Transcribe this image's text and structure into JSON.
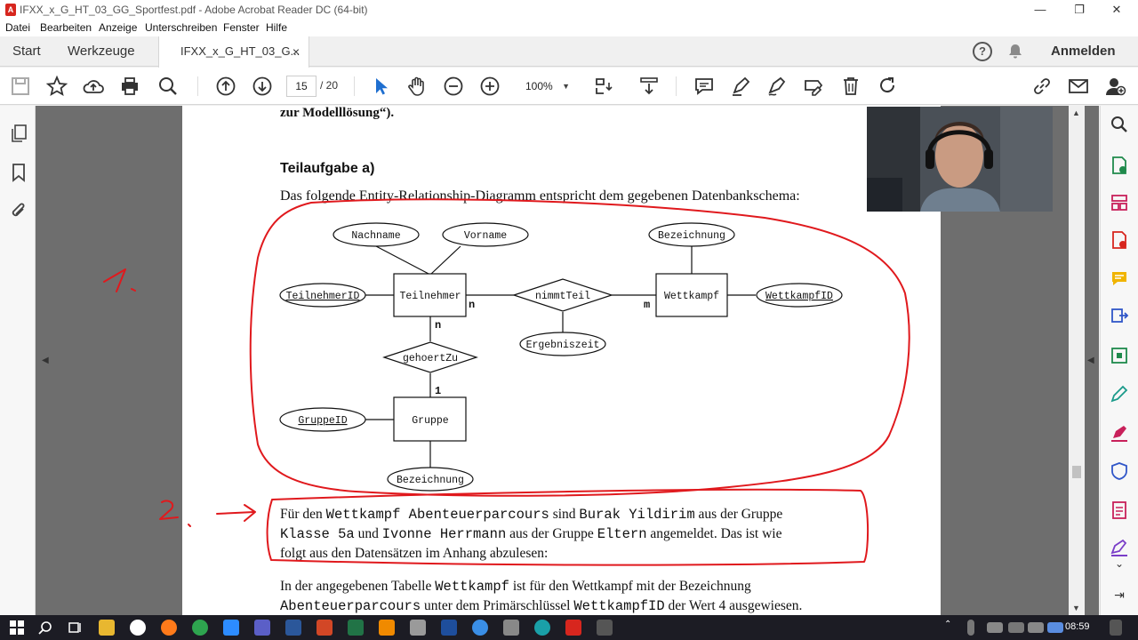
{
  "window": {
    "title": "IFXX_x_G_HT_03_GG_Sportfest.pdf - Adobe Acrobat Reader DC (64-bit)",
    "minimize": "—",
    "maximize": "❐",
    "close": "✕"
  },
  "menu": [
    "Datei",
    "Bearbeiten",
    "Anzeige",
    "Unterschreiben",
    "Fenster",
    "Hilfe"
  ],
  "tabs": {
    "start": "Start",
    "tools": "Werkzeuge",
    "doc": "IFXX_x_G_HT_03_G...",
    "doc_close": "×",
    "help": "?",
    "login": "Anmelden"
  },
  "toolbar": {
    "page_current": "15",
    "page_total": "/  20",
    "zoom": "100%"
  },
  "document": {
    "top_line": "zur Modelllösung“).",
    "heading": "Teilaufgabe a)",
    "intro": "Das folgende Entity-Relationship-Diagramm entspricht dem gegebenen Datenbankschema:",
    "er": {
      "entities": [
        "Teilnehmer",
        "Wettkampf",
        "Gruppe"
      ],
      "relationships": [
        "nimmtTeil",
        "gehoertZu"
      ],
      "attributes": [
        "Nachname",
        "Vorname",
        "Bezeichnung",
        "TeilnehmerID",
        "WettkampfID",
        "Ergebniszeit",
        "GruppeID",
        "Bezeichnung"
      ],
      "cardinalities": [
        "n",
        "m",
        "n",
        "1"
      ]
    },
    "para1": {
      "l1a": "Für den ",
      "l1b": "Wettkampf Abenteuerparcours",
      "l1c": " sind ",
      "l1d": "Burak Yildirim",
      "l1e": " aus der Gruppe",
      "l2a": "Klasse 5a",
      "l2b": " und ",
      "l2c": "Ivonne Herrmann",
      "l2d": " aus der Gruppe ",
      "l2e": "Eltern",
      "l2f": " angemeldet. Das ist wie",
      "l3": "folgt aus den Datensätzen im Anhang abzulesen:"
    },
    "para2": {
      "l1a": "In der angegebenen Tabelle ",
      "l1b": "Wettkampf",
      "l1c": " ist für den Wettkampf mit der Bezeichnung",
      "l2a": "Abenteuerparcours",
      "l2b": " unter dem Primärschlüssel ",
      "l2c": "WettkampfID",
      "l2d": " der Wert 4 ausgewiesen."
    }
  },
  "taskbar": {
    "time": "08:59"
  },
  "colors": {
    "annotation_red": "#e0191d",
    "page_bg": "#ffffff",
    "viewer_bg": "#6e6e6e",
    "taskbar": "#1c1c24"
  }
}
